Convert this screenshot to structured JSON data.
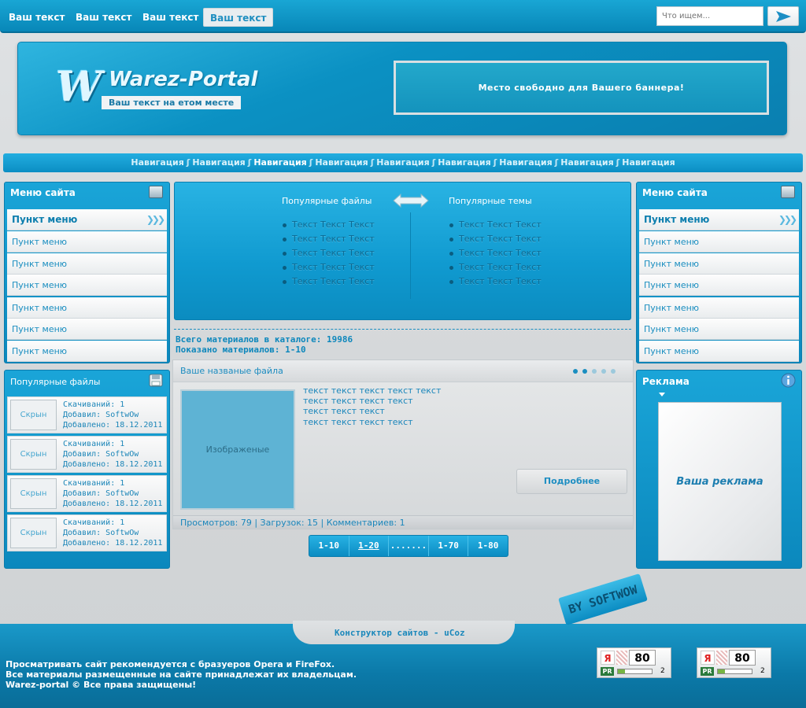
{
  "topbar": {
    "links": [
      "Ваш текст",
      "Ваш текст",
      "Ваш текст",
      "Ваш текст"
    ],
    "search_placeholder": "Что ищем..."
  },
  "header": {
    "logo_letter": "W",
    "logo_text": "Warez-Portal",
    "logo_subtitle": "Ваш текст на етом месте",
    "banner_text": "Место свободно для Вашего баннера!"
  },
  "nav": {
    "items": [
      "Навигация",
      "Навигация",
      "Навигация",
      "Навигация",
      "Навигация",
      "Навигация",
      "Навигация",
      "Навигация",
      "Навигация"
    ],
    "separator": "ʃ"
  },
  "left_menu": {
    "title": "Меню сайта",
    "items": [
      "Пункт меню",
      "Пункт меню",
      "Пункт меню",
      "Пункт меню",
      "Пункт меню",
      "Пункт меню",
      "Пункт меню"
    ]
  },
  "popular_files_panel": {
    "title": "Популярные файлы",
    "items": [
      {
        "thumb": "Скрын",
        "downloads": "Скачиваний: 1",
        "added_by": "Добавил: SoftwOw",
        "date": "Добавлено: 18.12.2011"
      },
      {
        "thumb": "Скрын",
        "downloads": "Скачиваний: 1",
        "added_by": "Добавил: SoftwOw",
        "date": "Добавлено: 18.12.2011"
      },
      {
        "thumb": "Скрын",
        "downloads": "Скачиваний: 1",
        "added_by": "Добавил: SoftwOw",
        "date": "Добавлено: 18.12.2011"
      },
      {
        "thumb": "Скрын",
        "downloads": "Скачиваний: 1",
        "added_by": "Добавил: SoftwOw",
        "date": "Добавлено: 18.12.2011"
      }
    ]
  },
  "popular_box": {
    "left_title": "Популярные файлы",
    "right_title": "Популярные темы",
    "left_items": [
      "Текст Текст Текст",
      "Текст Текст Текст",
      "Текст Текст Текст",
      "Текст Текст Текст",
      "Текст Текст Текст"
    ],
    "right_items": [
      "Текст Текст Текст",
      "Текст Текст Текст",
      "Текст Текст Текст",
      "Текст Текст Текст",
      "Текст Текст Текст"
    ]
  },
  "stats": {
    "total": "Всего материалов в каталоге: 19986",
    "shown": "Показано материалов: 1-10"
  },
  "entry": {
    "title": "Ваше названые файла",
    "image_label": "Изображеные",
    "lines": [
      "текст текст текст текст текст",
      "текст текст текст текст",
      "текст текст текст",
      "текст текст текст текст"
    ],
    "more_button": "Подробнее",
    "footer": "Просмотров: 79 | Загрузок: 15 | Комментариев: 1"
  },
  "pager": [
    "1-10",
    "1-20",
    ".......",
    "1-70",
    "1-80"
  ],
  "right_menu": {
    "title": "Меню сайта",
    "items": [
      "Пункт меню",
      "Пункт меню",
      "Пункт меню",
      "Пункт меню",
      "Пункт меню",
      "Пункт меню",
      "Пункт меню"
    ]
  },
  "ad_panel": {
    "title": "Реклама",
    "ad_text": "Ваша реклама"
  },
  "footer": {
    "credit": "Конструктор сайтов - uCoz",
    "tag": "BY SOFTWOW",
    "lines": [
      "Просматривать сайт рекомендуется с бразуеров Opera и FireFox.",
      "Все материалы размещенные на сайте принадлежат их владельцам.",
      "Warez-portal © Все права защищены!"
    ],
    "counters": [
      {
        "brand": "Я",
        "value": "80",
        "pr": "PR",
        "rank": "2"
      },
      {
        "brand": "Я",
        "value": "80",
        "pr": "PR",
        "rank": "2"
      }
    ]
  },
  "colors": {
    "accent": "#0b8ec3",
    "accent_light": "#22ade0",
    "text_link": "#1a8ec0"
  }
}
